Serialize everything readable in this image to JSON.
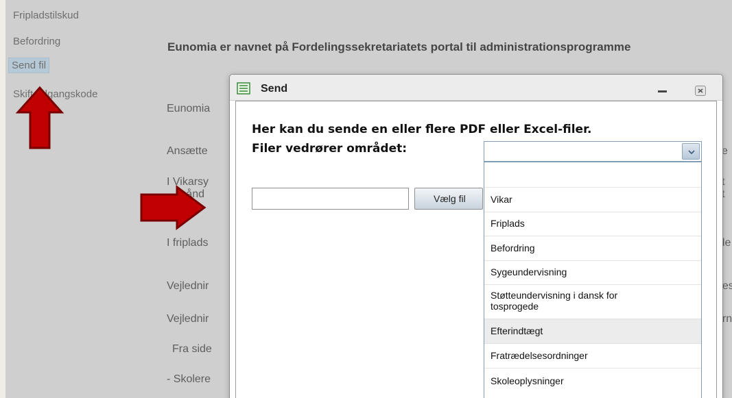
{
  "sidebar": {
    "items": [
      {
        "label": "Fripladstilskud"
      },
      {
        "label": "Befordring"
      },
      {
        "label": "Send fil"
      },
      {
        "label": "Skift adgangskode"
      }
    ]
  },
  "main": {
    "heading": "Eunomia er navnet på Fordelingssekretariatets portal til administrationsprogramme",
    "lines_left": [
      "Eunomia",
      "Ansætte",
      "I Vikarsy",
      "månd",
      "I friplads",
      "Vejlednir",
      "Vejlednir",
      "Fra side",
      "- Skolere"
    ],
    "lines_right": [
      "se",
      "st",
      "st",
      "ole",
      "nes",
      "ern"
    ]
  },
  "dialog": {
    "title": "Send",
    "intro": "Her kan du sende en eller flere PDF eller Excel-filer.",
    "area_label": "Filer vedrører området:",
    "file_value": "",
    "choose_button": "Vælg fil",
    "select_value": "",
    "options": [
      "",
      "Vikar",
      "Friplads",
      "Befordring",
      "Sygeundervisning",
      "Støtteundervisning i dansk for tosprogede",
      "Efterindtægt",
      "Fratrædelsesordninger",
      "Skoleoplysninger"
    ],
    "highlighted_option": "Efterindtægt"
  },
  "colors": {
    "arrow": "#c00000",
    "overlay": "#cfcfcf",
    "nav_active": "#b6c9d6"
  }
}
